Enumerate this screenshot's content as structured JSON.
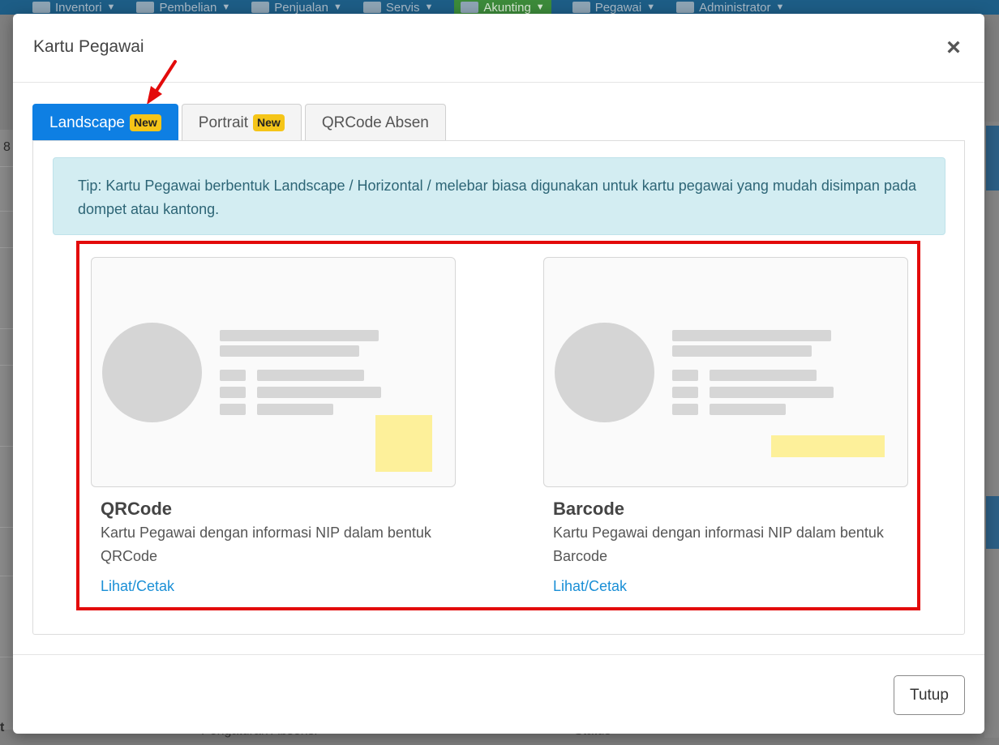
{
  "background_nav": {
    "items": [
      {
        "label": "Inventori",
        "icon": "box-icon"
      },
      {
        "label": "Pembelian",
        "icon": "cart-icon"
      },
      {
        "label": "Penjualan",
        "icon": "document-icon"
      },
      {
        "label": "Servis",
        "icon": "gears-icon"
      },
      {
        "label": "Akunting",
        "icon": "ledger-icon",
        "active": true
      },
      {
        "label": "Pegawai",
        "icon": "id-card-icon"
      },
      {
        "label": "Administrator",
        "icon": "gear-icon"
      }
    ]
  },
  "background": {
    "left_number": "8",
    "left_letter": "t",
    "bottom_text_1": "Pengaturan Absensi",
    "bottom_text_2": "Status"
  },
  "modal": {
    "title": "Kartu Pegawai",
    "close_symbol": "×",
    "tabs": [
      {
        "label": "Landscape",
        "badge": "New",
        "active": true
      },
      {
        "label": "Portrait",
        "badge": "New",
        "active": false
      },
      {
        "label": "QRCode Absen",
        "badge": "",
        "active": false
      }
    ],
    "tip": "Tip: Kartu Pegawai berbentuk Landscape / Horizontal / melebar biasa digunakan untuk kartu pegawai yang mudah disimpan pada dompet atau kantong.",
    "cards": [
      {
        "title": "QRCode",
        "description": "Kartu Pegawai dengan informasi NIP dalam bentuk QRCode",
        "link": "Lihat/Cetak",
        "code_type": "qrcode"
      },
      {
        "title": "Barcode",
        "description": "Kartu Pegawai dengan informasi NIP dalam bentuk Barcode",
        "link": "Lihat/Cetak",
        "code_type": "barcode"
      }
    ],
    "footer_button": "Tutup"
  },
  "colors": {
    "tab_active": "#0e7fe3",
    "badge": "#f5c518",
    "tip_background": "#d3edf2",
    "highlight_border": "#e30b0b",
    "link": "#1a8fd6",
    "code_placeholder": "#fdf09a",
    "annotation_arrow": "#e30b0b"
  }
}
